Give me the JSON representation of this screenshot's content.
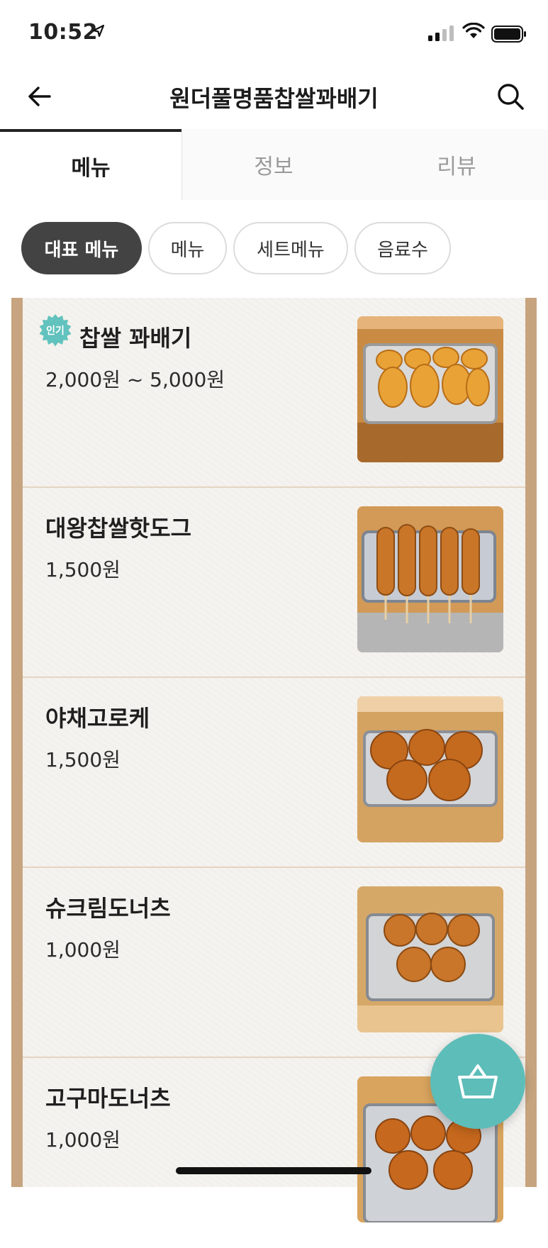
{
  "status_bar": {
    "time": "10:52"
  },
  "header": {
    "title": "원더풀명품찹쌀꽈배기"
  },
  "tabs": [
    {
      "label": "메뉴",
      "active": true
    },
    {
      "label": "정보",
      "active": false
    },
    {
      "label": "리뷰",
      "active": false
    }
  ],
  "categories": [
    {
      "label": "대표 메뉴",
      "selected": true
    },
    {
      "label": "메뉴",
      "selected": false
    },
    {
      "label": "세트메뉴",
      "selected": false
    },
    {
      "label": "음료수",
      "selected": false
    }
  ],
  "menu_items": [
    {
      "name": "찹쌀 꽈배기",
      "price": "2,000원 ~ 5,000원",
      "badge": "인기",
      "thumb_icon": "twisted-donut-photo-icon"
    },
    {
      "name": "대왕찹쌀핫도그",
      "price": "1,500원",
      "thumb_icon": "corn-dog-photo-icon"
    },
    {
      "name": "야채고로케",
      "price": "1,500원",
      "thumb_icon": "croquette-photo-icon"
    },
    {
      "name": "슈크림도너츠",
      "price": "1,000원",
      "thumb_icon": "cream-donut-photo-icon"
    },
    {
      "name": "고구마도너츠",
      "price": "1,000원",
      "thumb_icon": "sweet-potato-donut-photo-icon"
    }
  ],
  "colors": {
    "accent_teal": "#5dbdb9",
    "chip_selected": "#434343",
    "wood_border": "#c6a47f"
  },
  "icons": {
    "back": "back-arrow-icon",
    "search": "search-icon",
    "cart": "shopping-basket-icon"
  }
}
